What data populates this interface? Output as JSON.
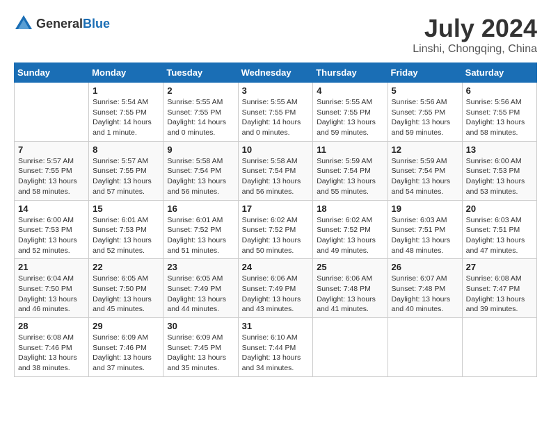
{
  "header": {
    "logo_general": "General",
    "logo_blue": "Blue",
    "month_year": "July 2024",
    "location": "Linshi, Chongqing, China"
  },
  "calendar": {
    "days_of_week": [
      "Sunday",
      "Monday",
      "Tuesday",
      "Wednesday",
      "Thursday",
      "Friday",
      "Saturday"
    ],
    "weeks": [
      [
        {
          "day": "",
          "info": ""
        },
        {
          "day": "1",
          "info": "Sunrise: 5:54 AM\nSunset: 7:55 PM\nDaylight: 14 hours\nand 1 minute."
        },
        {
          "day": "2",
          "info": "Sunrise: 5:55 AM\nSunset: 7:55 PM\nDaylight: 14 hours\nand 0 minutes."
        },
        {
          "day": "3",
          "info": "Sunrise: 5:55 AM\nSunset: 7:55 PM\nDaylight: 14 hours\nand 0 minutes."
        },
        {
          "day": "4",
          "info": "Sunrise: 5:55 AM\nSunset: 7:55 PM\nDaylight: 13 hours\nand 59 minutes."
        },
        {
          "day": "5",
          "info": "Sunrise: 5:56 AM\nSunset: 7:55 PM\nDaylight: 13 hours\nand 59 minutes."
        },
        {
          "day": "6",
          "info": "Sunrise: 5:56 AM\nSunset: 7:55 PM\nDaylight: 13 hours\nand 58 minutes."
        }
      ],
      [
        {
          "day": "7",
          "info": "Sunrise: 5:57 AM\nSunset: 7:55 PM\nDaylight: 13 hours\nand 58 minutes."
        },
        {
          "day": "8",
          "info": "Sunrise: 5:57 AM\nSunset: 7:55 PM\nDaylight: 13 hours\nand 57 minutes."
        },
        {
          "day": "9",
          "info": "Sunrise: 5:58 AM\nSunset: 7:54 PM\nDaylight: 13 hours\nand 56 minutes."
        },
        {
          "day": "10",
          "info": "Sunrise: 5:58 AM\nSunset: 7:54 PM\nDaylight: 13 hours\nand 56 minutes."
        },
        {
          "day": "11",
          "info": "Sunrise: 5:59 AM\nSunset: 7:54 PM\nDaylight: 13 hours\nand 55 minutes."
        },
        {
          "day": "12",
          "info": "Sunrise: 5:59 AM\nSunset: 7:54 PM\nDaylight: 13 hours\nand 54 minutes."
        },
        {
          "day": "13",
          "info": "Sunrise: 6:00 AM\nSunset: 7:53 PM\nDaylight: 13 hours\nand 53 minutes."
        }
      ],
      [
        {
          "day": "14",
          "info": "Sunrise: 6:00 AM\nSunset: 7:53 PM\nDaylight: 13 hours\nand 52 minutes."
        },
        {
          "day": "15",
          "info": "Sunrise: 6:01 AM\nSunset: 7:53 PM\nDaylight: 13 hours\nand 52 minutes."
        },
        {
          "day": "16",
          "info": "Sunrise: 6:01 AM\nSunset: 7:52 PM\nDaylight: 13 hours\nand 51 minutes."
        },
        {
          "day": "17",
          "info": "Sunrise: 6:02 AM\nSunset: 7:52 PM\nDaylight: 13 hours\nand 50 minutes."
        },
        {
          "day": "18",
          "info": "Sunrise: 6:02 AM\nSunset: 7:52 PM\nDaylight: 13 hours\nand 49 minutes."
        },
        {
          "day": "19",
          "info": "Sunrise: 6:03 AM\nSunset: 7:51 PM\nDaylight: 13 hours\nand 48 minutes."
        },
        {
          "day": "20",
          "info": "Sunrise: 6:03 AM\nSunset: 7:51 PM\nDaylight: 13 hours\nand 47 minutes."
        }
      ],
      [
        {
          "day": "21",
          "info": "Sunrise: 6:04 AM\nSunset: 7:50 PM\nDaylight: 13 hours\nand 46 minutes."
        },
        {
          "day": "22",
          "info": "Sunrise: 6:05 AM\nSunset: 7:50 PM\nDaylight: 13 hours\nand 45 minutes."
        },
        {
          "day": "23",
          "info": "Sunrise: 6:05 AM\nSunset: 7:49 PM\nDaylight: 13 hours\nand 44 minutes."
        },
        {
          "day": "24",
          "info": "Sunrise: 6:06 AM\nSunset: 7:49 PM\nDaylight: 13 hours\nand 43 minutes."
        },
        {
          "day": "25",
          "info": "Sunrise: 6:06 AM\nSunset: 7:48 PM\nDaylight: 13 hours\nand 41 minutes."
        },
        {
          "day": "26",
          "info": "Sunrise: 6:07 AM\nSunset: 7:48 PM\nDaylight: 13 hours\nand 40 minutes."
        },
        {
          "day": "27",
          "info": "Sunrise: 6:08 AM\nSunset: 7:47 PM\nDaylight: 13 hours\nand 39 minutes."
        }
      ],
      [
        {
          "day": "28",
          "info": "Sunrise: 6:08 AM\nSunset: 7:46 PM\nDaylight: 13 hours\nand 38 minutes."
        },
        {
          "day": "29",
          "info": "Sunrise: 6:09 AM\nSunset: 7:46 PM\nDaylight: 13 hours\nand 37 minutes."
        },
        {
          "day": "30",
          "info": "Sunrise: 6:09 AM\nSunset: 7:45 PM\nDaylight: 13 hours\nand 35 minutes."
        },
        {
          "day": "31",
          "info": "Sunrise: 6:10 AM\nSunset: 7:44 PM\nDaylight: 13 hours\nand 34 minutes."
        },
        {
          "day": "",
          "info": ""
        },
        {
          "day": "",
          "info": ""
        },
        {
          "day": "",
          "info": ""
        }
      ]
    ]
  }
}
